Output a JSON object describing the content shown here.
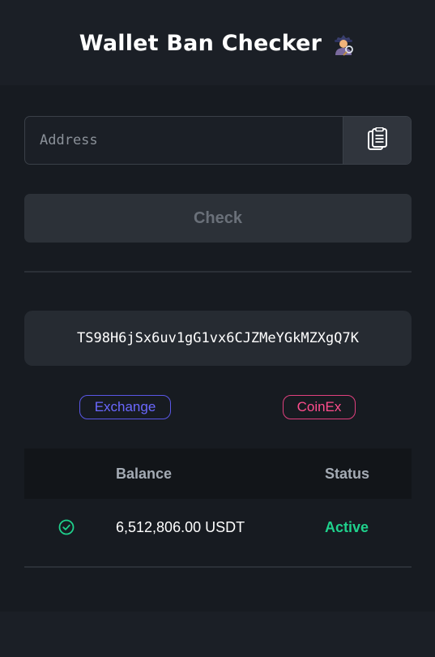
{
  "header": {
    "title": "Wallet Ban Checker",
    "emoji_icon": "detective-icon"
  },
  "form": {
    "address_placeholder": "Address",
    "address_value": "",
    "paste_icon": "clipboard-icon",
    "check_label": "Check"
  },
  "result": {
    "address": "TS98H6jSx6uv1gG1vx6CJZMeYGkMZXgQ7K",
    "tags": [
      {
        "label": "Exchange",
        "color": "#6b68ff"
      },
      {
        "label": "CoinEx",
        "color": "#ff4d8d"
      }
    ],
    "table": {
      "headers": {
        "balance": "Balance",
        "status": "Status"
      },
      "rows": [
        {
          "icon": "check-circle-icon",
          "balance": "6,512,806.00 USDT",
          "status": "Active"
        }
      ]
    }
  },
  "colors": {
    "background": "#171b21",
    "active_green": "#1fd18c"
  }
}
